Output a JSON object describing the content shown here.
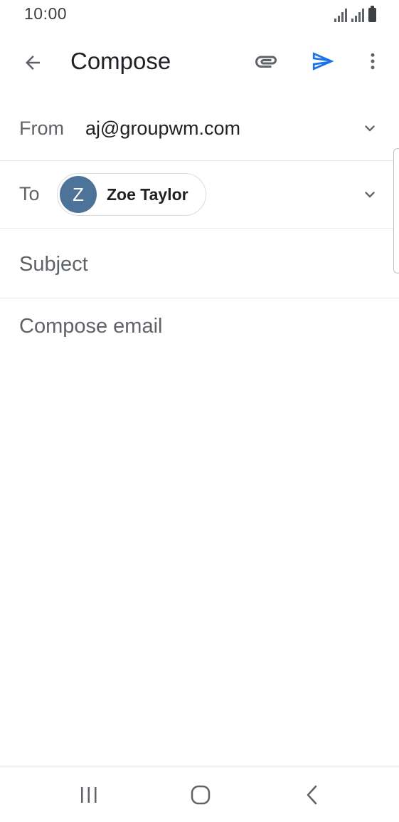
{
  "status_bar": {
    "time": "10:00",
    "icons": [
      "signal-icon",
      "signal-icon",
      "battery-icon"
    ]
  },
  "app_bar": {
    "title": "Compose",
    "icons": {
      "back": "arrow-left-icon",
      "attach": "paperclip-icon",
      "send": "send-icon",
      "more": "more-vert-icon"
    }
  },
  "from": {
    "label": "From",
    "value": "aj@groupwm.com"
  },
  "to": {
    "label": "To",
    "recipients": [
      {
        "initial": "Z",
        "name": "Zoe Taylor",
        "avatar_color": "#4d7398"
      }
    ]
  },
  "subject": {
    "value": "",
    "placeholder": "Subject"
  },
  "body": {
    "value": "",
    "placeholder": "Compose email"
  },
  "colors": {
    "accent": "#1a73e8",
    "text_primary": "#202124",
    "text_secondary": "#5f6368",
    "divider": "#e8eaed"
  },
  "nav_bar": {
    "icons": [
      "recents-icon",
      "home-icon",
      "back-icon"
    ]
  }
}
